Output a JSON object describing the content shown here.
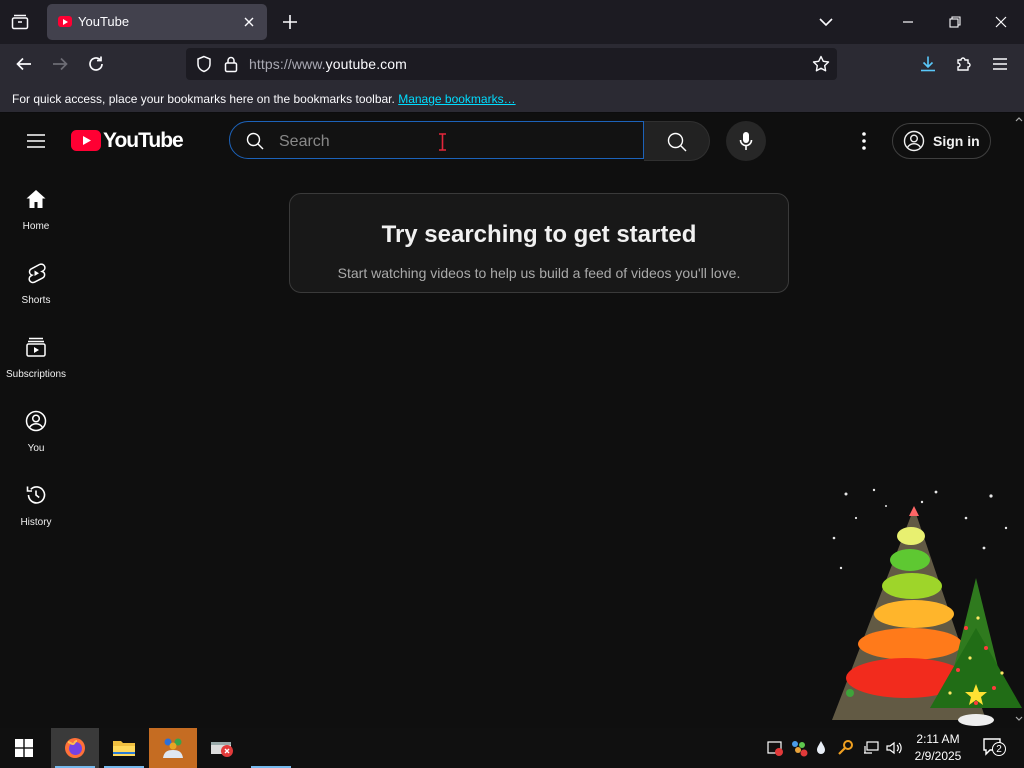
{
  "browser": {
    "tab": {
      "title": "YouTube"
    },
    "url": {
      "scheme": "https://www.",
      "host": "youtube.com"
    },
    "bookmarks_bar": {
      "message": "For quick access, place your bookmarks here on the bookmarks toolbar.",
      "link": "Manage bookmarks…"
    }
  },
  "youtube": {
    "logo_text": "YouTube",
    "search": {
      "placeholder": "Search"
    },
    "sign_in_label": "Sign in",
    "guide": [
      {
        "label": "Home",
        "icon": "home-icon"
      },
      {
        "label": "Shorts",
        "icon": "shorts-icon"
      },
      {
        "label": "Subscriptions",
        "icon": "subscriptions-icon"
      },
      {
        "label": "You",
        "icon": "you-icon"
      },
      {
        "label": "History",
        "icon": "history-icon"
      }
    ],
    "empty_state": {
      "title": "Try searching to get started",
      "subtitle": "Start watching videos to help us build a feed of videos you'll love."
    },
    "brand_color": "#ff0033"
  },
  "taskbar": {
    "time": "2:11 AM",
    "date": "2/9/2025",
    "notification_count": "2",
    "apps": [
      "firefox-icon",
      "file-explorer-icon",
      "people-app-icon",
      "security-app-icon"
    ]
  }
}
